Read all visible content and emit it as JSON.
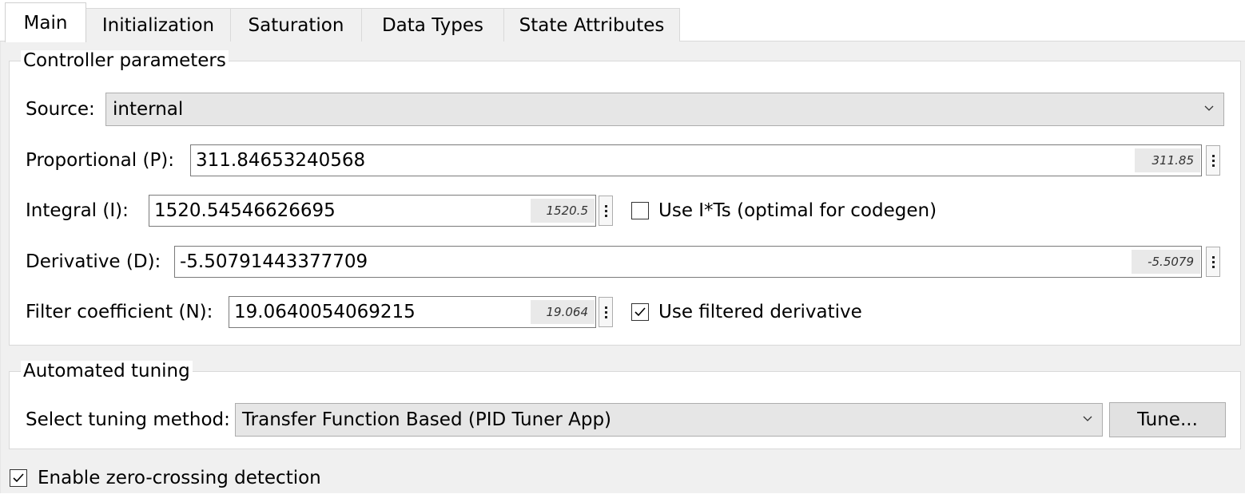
{
  "tabs": [
    {
      "label": "Main",
      "active": true
    },
    {
      "label": "Initialization"
    },
    {
      "label": "Saturation"
    },
    {
      "label": "Data Types"
    },
    {
      "label": "State Attributes"
    }
  ],
  "controller": {
    "legend": "Controller parameters",
    "source": {
      "label": "Source:",
      "value": "internal"
    },
    "proportional": {
      "label": "Proportional (P):",
      "value": "311.84653240568",
      "display": "311.85"
    },
    "integral": {
      "label": "Integral (I):",
      "value": "1520.54546626695",
      "display": "1520.5"
    },
    "use_its": {
      "label": "Use I*Ts (optimal for codegen)",
      "checked": false
    },
    "derivative": {
      "label": "Derivative (D):",
      "value": "-5.50791443377709",
      "display": "-5.5079"
    },
    "filter": {
      "label": "Filter coefficient (N):",
      "value": "19.0640054069215",
      "display": "19.064"
    },
    "use_filtered": {
      "label": "Use filtered derivative",
      "checked": true
    }
  },
  "tuning": {
    "legend": "Automated tuning",
    "method_label": "Select tuning method:",
    "method_value": "Transfer Function Based (PID Tuner App)",
    "tune_button": "Tune..."
  },
  "zero_crossing": {
    "label": "Enable zero-crossing detection",
    "checked": true
  }
}
